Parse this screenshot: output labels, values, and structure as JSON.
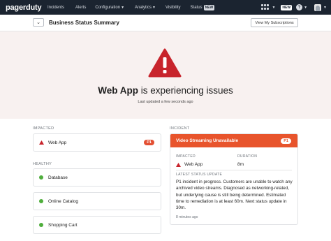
{
  "nav": {
    "logo": "pagerduty",
    "items": [
      {
        "label": "Incidents"
      },
      {
        "label": "Alerts"
      },
      {
        "label": "Configuration",
        "dropdown": true
      },
      {
        "label": "Analytics",
        "dropdown": true
      },
      {
        "label": "Visibility"
      },
      {
        "label": "Status",
        "badge": "NEW"
      }
    ],
    "new_label": "NEW",
    "help_label": "?"
  },
  "header": {
    "back_icon": "chevron-down-icon",
    "title": "Business Status Summary",
    "subscriptions_button": "View My Subscriptions"
  },
  "hero": {
    "service": "Web App",
    "status_text": " is experiencing issues",
    "updated": "Last updated a few seconds ago",
    "icon": "warning-triangle-icon",
    "icon_color": "#c8242c"
  },
  "impacted": {
    "label": "IMPACTED",
    "services": [
      {
        "name": "Web App",
        "priority": "P1"
      }
    ]
  },
  "healthy": {
    "label": "HEALTHY",
    "services": [
      {
        "name": "Database"
      },
      {
        "name": "Online Catalog"
      },
      {
        "name": "Shopping Cart"
      }
    ],
    "status_color": "#4fae3c"
  },
  "incident": {
    "label": "INCIDENT",
    "title": "Video Streaming Unavailable",
    "priority": "P1",
    "impacted_label": "IMPACTED",
    "impacted_service": "Web App",
    "duration_label": "DURATION",
    "duration": "8m",
    "latest_label": "LATEST STATUS UPDATE",
    "update_text": "P1 incident in progress. Customers are unable to watch any archived video streams. Diagnosed as networking-related, but underlying cause is still being determined. Estimated time to remediation is at least 60m. Next status update in 30m.",
    "update_time": "8 minutes ago",
    "accent_color": "#e8542c"
  }
}
